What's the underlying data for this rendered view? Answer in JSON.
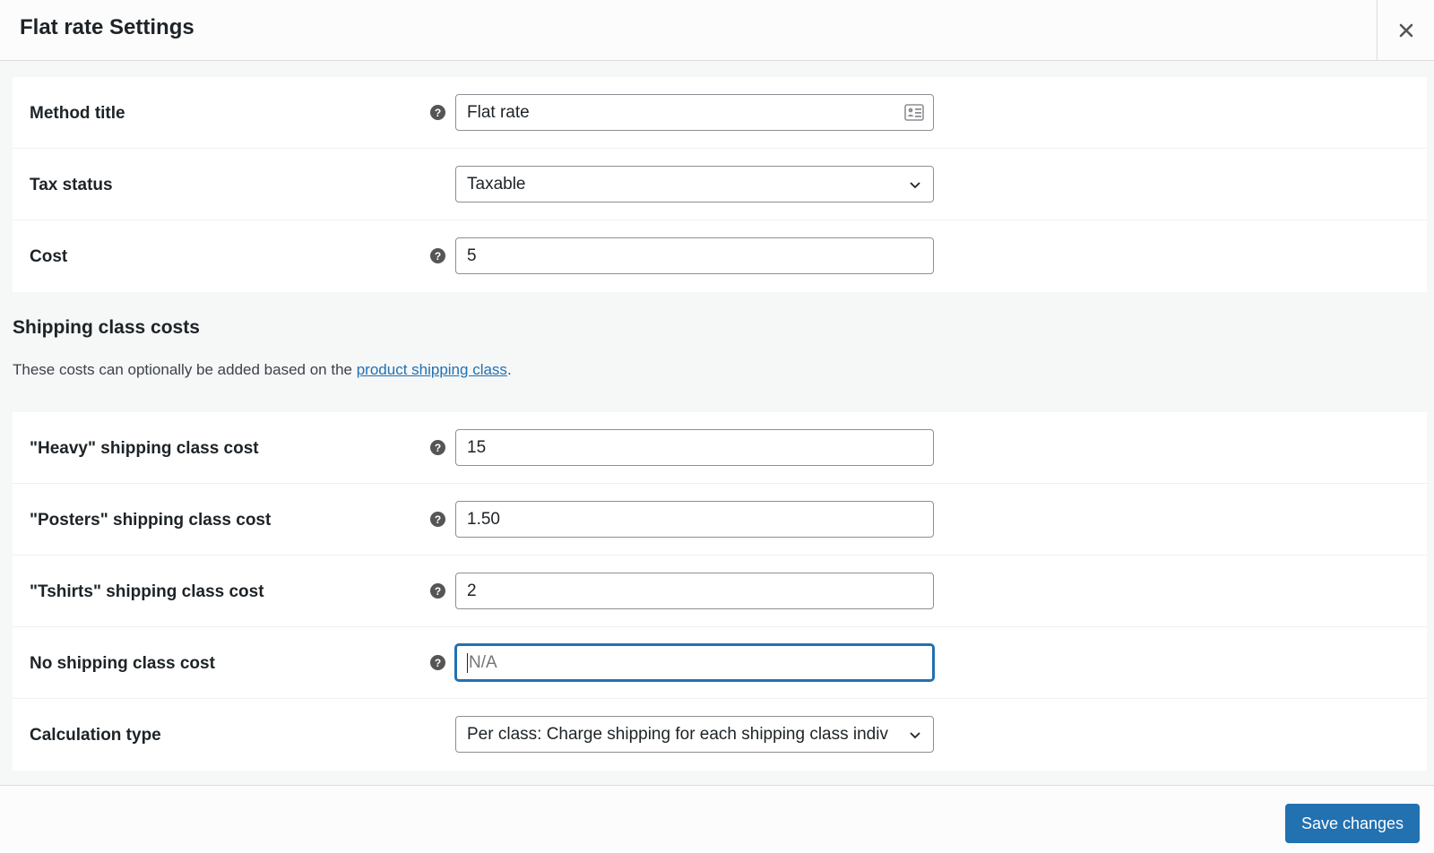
{
  "modal": {
    "title": "Flat rate Settings",
    "close_icon": "close-icon"
  },
  "general": {
    "rows": [
      {
        "label": "Method title",
        "type": "text",
        "value": "Flat rate",
        "has_help": true,
        "trailing_icon": "contact-card-icon"
      },
      {
        "label": "Tax status",
        "type": "select",
        "value": "Taxable",
        "has_help": false
      },
      {
        "label": "Cost",
        "type": "text",
        "value": "5",
        "has_help": true
      }
    ]
  },
  "shipping_classes": {
    "title": "Shipping class costs",
    "description_prefix": "These costs can optionally be added based on the ",
    "description_link": "product shipping class",
    "description_suffix": ".",
    "rows": [
      {
        "label": "\"Heavy\" shipping class cost",
        "type": "text",
        "value": "15",
        "has_help": true
      },
      {
        "label": "\"Posters\" shipping class cost",
        "type": "text",
        "value": "1.50",
        "has_help": true
      },
      {
        "label": "\"Tshirts\" shipping class cost",
        "type": "text",
        "value": "2",
        "has_help": true
      },
      {
        "label": "No shipping class cost",
        "type": "text",
        "value": "",
        "placeholder": "N/A",
        "focused": true,
        "has_help": true
      },
      {
        "label": "Calculation type",
        "type": "select",
        "value": "Per class: Charge shipping for each shipping class indiv",
        "has_help": false
      }
    ]
  },
  "help_glyph": "?",
  "footer": {
    "save_label": "Save changes"
  },
  "colors": {
    "accent": "#2271b1",
    "help_icon": "#555555"
  }
}
